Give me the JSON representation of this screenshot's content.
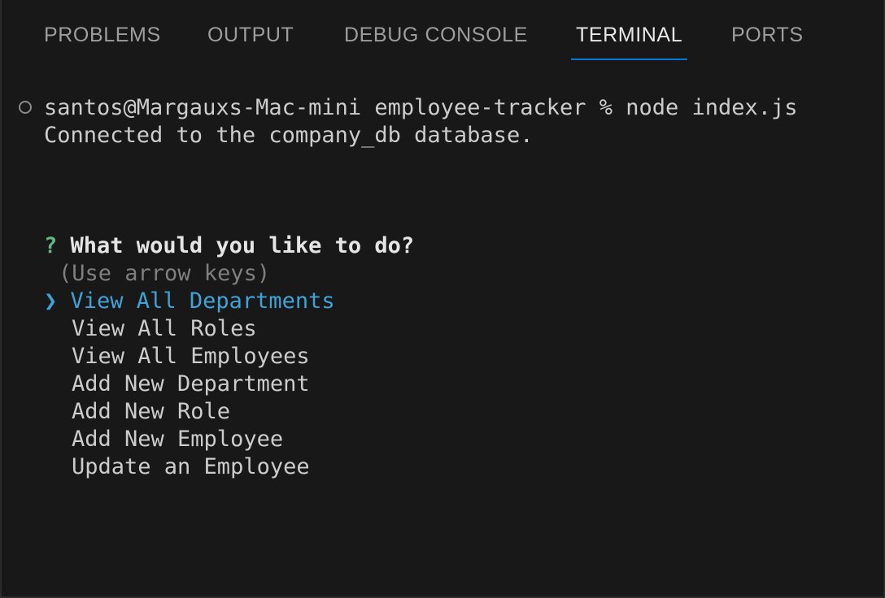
{
  "tabs": [
    {
      "label": "PROBLEMS",
      "active": false
    },
    {
      "label": "OUTPUT",
      "active": false
    },
    {
      "label": "DEBUG CONSOLE",
      "active": false
    },
    {
      "label": "TERMINAL",
      "active": true
    },
    {
      "label": "PORTS",
      "active": false
    }
  ],
  "terminal": {
    "command_line": "santos@Margauxs-Mac-mini employee-tracker % node index.js",
    "output_line": "Connected to the company_db database.",
    "prompt": {
      "marker": "?",
      "question": "What would you like to do?",
      "hint": "(Use arrow keys)",
      "pointer": "❯",
      "choices": [
        "View All Departments",
        "View All Roles",
        "View All Employees",
        "Add New Department",
        "Add New Role",
        "Add New Employee",
        "Update an Employee"
      ],
      "selected_index": 0
    }
  },
  "colors": {
    "background": "#181818",
    "active_tab_underline": "#0078d4",
    "prompt_marker": "#5fb885",
    "selection": "#3ea3d6"
  }
}
